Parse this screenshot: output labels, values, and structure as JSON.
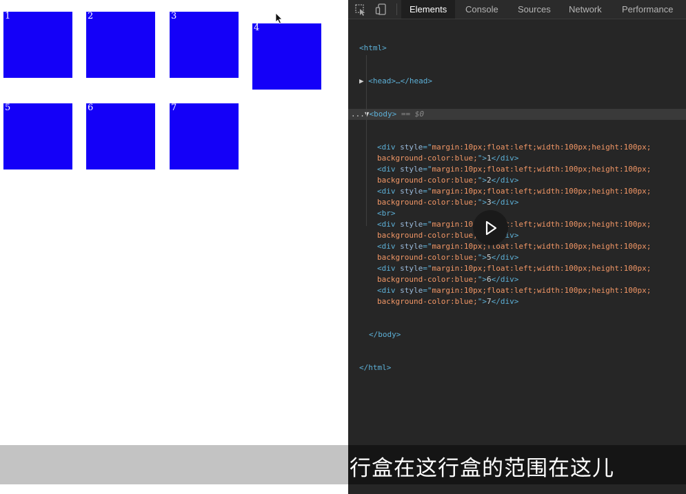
{
  "viewport": {
    "boxes": [
      {
        "label": "1"
      },
      {
        "label": "2"
      },
      {
        "label": "3"
      },
      {
        "label": "4"
      },
      {
        "label": "5"
      },
      {
        "label": "6"
      },
      {
        "label": "7"
      }
    ],
    "box_color": "#1400f8"
  },
  "devtools": {
    "tabs": [
      "Elements",
      "Console",
      "Sources",
      "Network",
      "Performance"
    ],
    "active_tab": "Elements",
    "code": {
      "html_open": "<html>",
      "head_line": "<head>…</head>",
      "body_open": "<body>",
      "body_marker": "== $0",
      "ellipsis": "...",
      "div_attr_name": "style",
      "div_style_part1": "margin:10px;float:left;width:100px;height:100px;",
      "div_style_part2": "background-color:blue;",
      "div_items": [
        "1",
        "2",
        "3",
        "4",
        "5",
        "6",
        "7"
      ],
      "br_tag": "<br>",
      "body_close": "</body>",
      "html_close": "</html>",
      "div_open": "<div ",
      "div_close": "</div>"
    }
  },
  "subtitle": {
    "text": "行盒在这行盒的范围在这儿"
  },
  "icons": {
    "inspect": "inspect-element-icon",
    "device": "device-toolbar-icon",
    "play": "play-icon",
    "cursor": "mouse-cursor-icon"
  }
}
